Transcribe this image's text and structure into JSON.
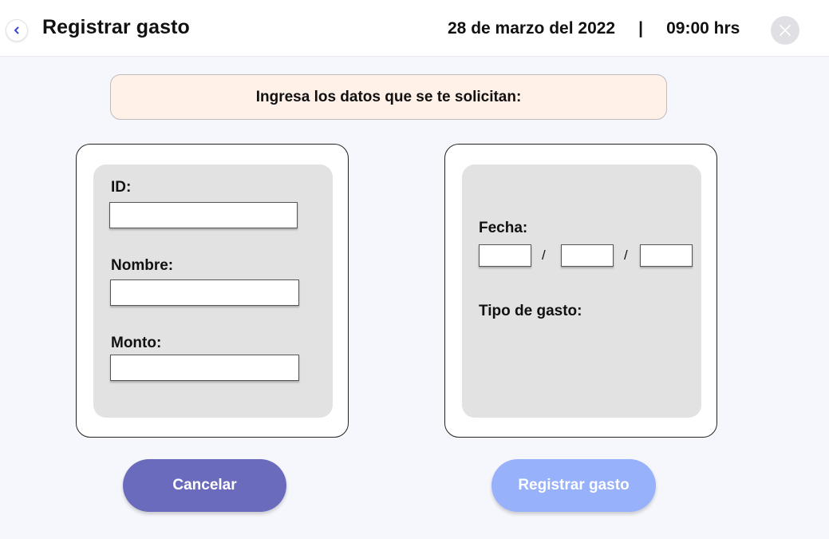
{
  "header": {
    "title": "Registrar gasto",
    "date": "28 de marzo del 2022",
    "separator": "|",
    "time": "09:00 hrs",
    "back_icon": "chevron-left-icon",
    "close_icon": "close-icon"
  },
  "instructions": "Ingresa los datos que se te solicitan:",
  "form_left": {
    "id_label": "ID:",
    "id_value": "",
    "name_label": "Nombre:",
    "name_value": "",
    "amount_label": "Monto:",
    "amount_value": ""
  },
  "form_right": {
    "date_label": "Fecha:",
    "date_day": "",
    "date_month": "",
    "date_year": "",
    "date_separator": "/",
    "type_label": "Tipo de gasto:"
  },
  "buttons": {
    "cancel": "Cancelar",
    "submit": "Registrar gasto"
  },
  "colors": {
    "accent": "#6a6bbd",
    "back_icon": "#3b47c8",
    "submit_disabled": "#97b1fb",
    "banner": "#fff0e8",
    "panel": "#e2e2e3"
  }
}
